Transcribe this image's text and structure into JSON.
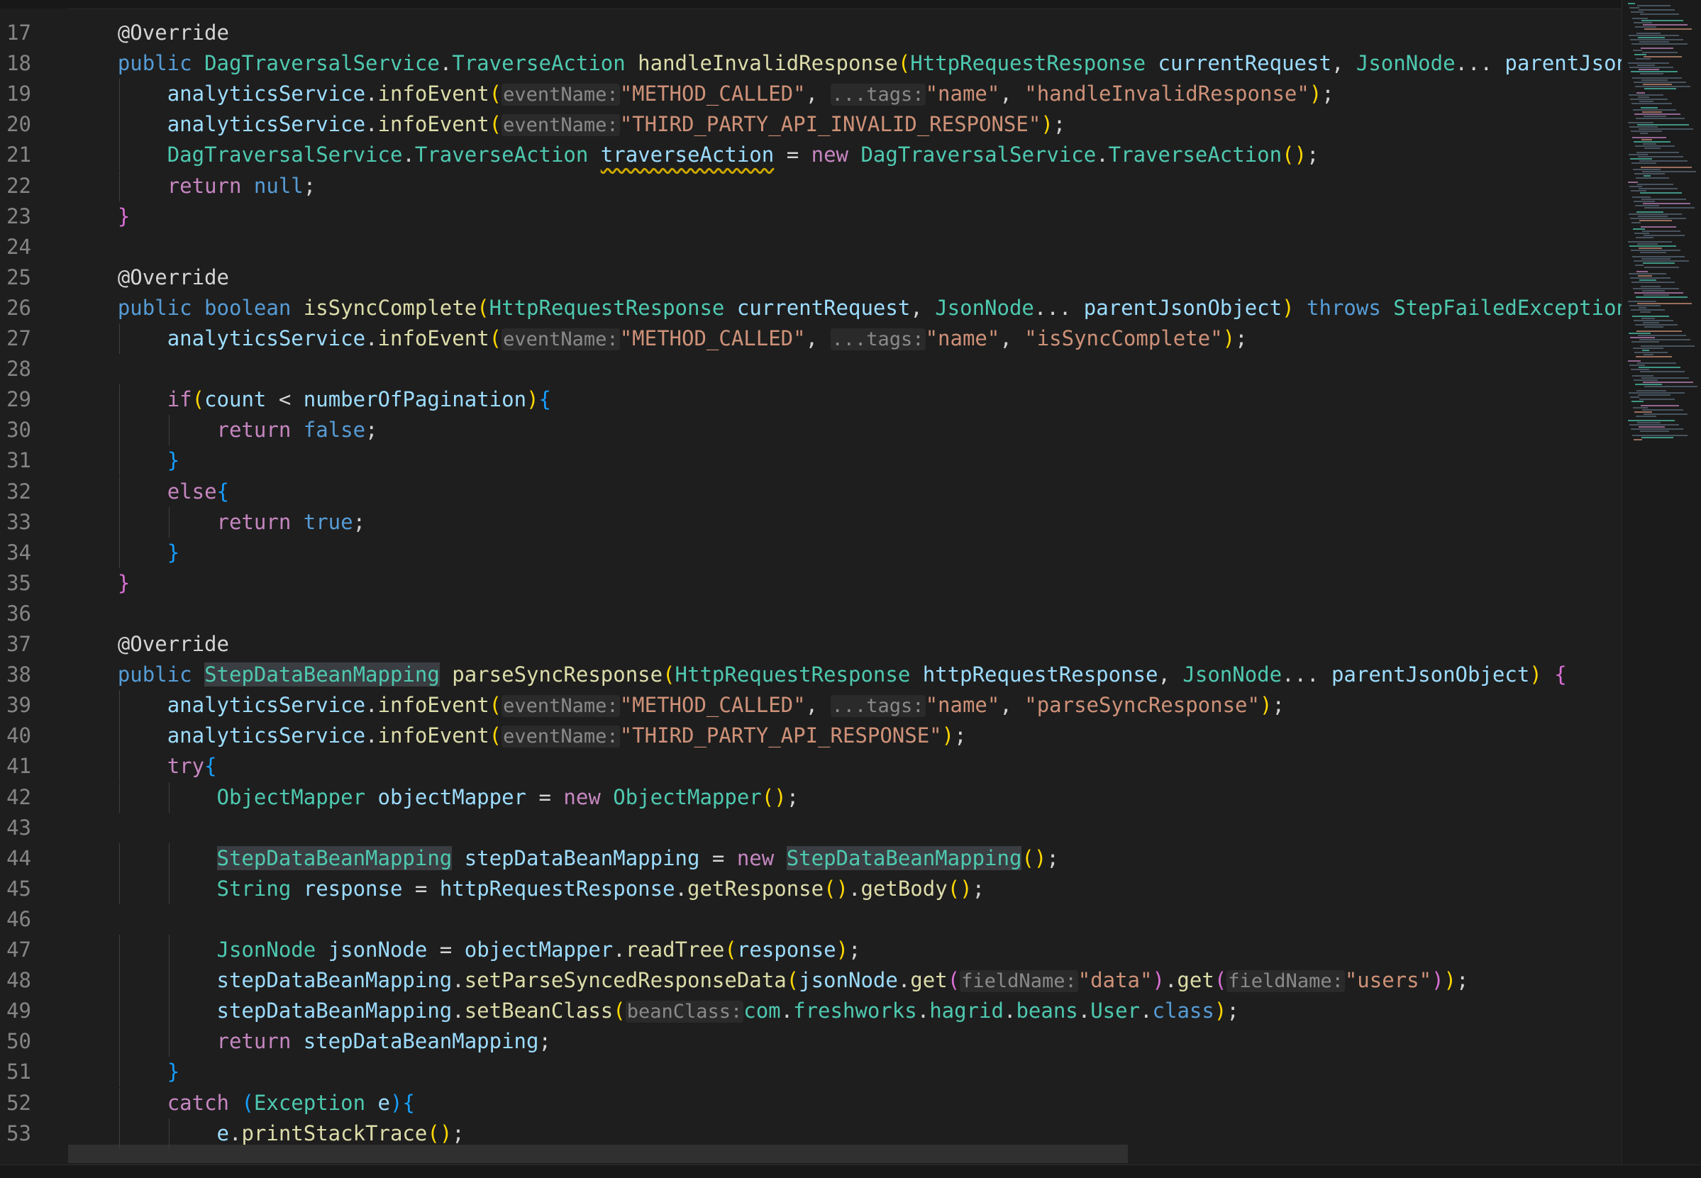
{
  "editor": {
    "lines": [
      {
        "n": "17",
        "indent": 1,
        "tokens": [
          {
            "c": "a",
            "t": "@Override"
          }
        ]
      },
      {
        "n": "18",
        "indent": 1,
        "tokens": [
          {
            "c": "kb",
            "t": "public "
          },
          {
            "c": "t",
            "t": "DagTraversalService"
          },
          {
            "c": "a",
            "t": "."
          },
          {
            "c": "t",
            "t": "TraverseAction "
          },
          {
            "c": "f",
            "t": "handleInvalidResponse"
          },
          {
            "c": "br1",
            "t": "("
          },
          {
            "c": "t",
            "t": "HttpRequestResponse "
          },
          {
            "c": "v",
            "t": "currentRequest"
          },
          {
            "c": "a",
            "t": ", "
          },
          {
            "c": "t",
            "t": "JsonNode"
          },
          {
            "c": "a",
            "t": "... "
          },
          {
            "c": "v",
            "t": "parentJsonO"
          }
        ]
      },
      {
        "n": "19",
        "indent": 2,
        "tokens": [
          {
            "c": "v",
            "t": "analyticsService"
          },
          {
            "c": "a",
            "t": "."
          },
          {
            "c": "f",
            "t": "infoEvent"
          },
          {
            "c": "br1",
            "t": "("
          },
          {
            "c": "hint",
            "t": "eventName:"
          },
          {
            "c": "s",
            "t": "\"METHOD_CALLED\""
          },
          {
            "c": "a",
            "t": ", "
          },
          {
            "c": "hint",
            "t": "...tags:"
          },
          {
            "c": "s",
            "t": "\"name\""
          },
          {
            "c": "a",
            "t": ", "
          },
          {
            "c": "s",
            "t": "\"handleInvalidResponse\""
          },
          {
            "c": "br1",
            "t": ")"
          },
          {
            "c": "a",
            "t": ";"
          }
        ]
      },
      {
        "n": "20",
        "indent": 2,
        "tokens": [
          {
            "c": "v",
            "t": "analyticsService"
          },
          {
            "c": "a",
            "t": "."
          },
          {
            "c": "f",
            "t": "infoEvent"
          },
          {
            "c": "br1",
            "t": "("
          },
          {
            "c": "hint",
            "t": "eventName:"
          },
          {
            "c": "s",
            "t": "\"THIRD_PARTY_API_INVALID_RESPONSE\""
          },
          {
            "c": "br1",
            "t": ")"
          },
          {
            "c": "a",
            "t": ";"
          }
        ]
      },
      {
        "n": "21",
        "indent": 2,
        "tokens": [
          {
            "c": "t",
            "t": "DagTraversalService"
          },
          {
            "c": "a",
            "t": "."
          },
          {
            "c": "t",
            "t": "TraverseAction "
          },
          {
            "c": "v squig",
            "t": "traverseAction"
          },
          {
            "c": "a",
            "t": " = "
          },
          {
            "c": "k",
            "t": "new "
          },
          {
            "c": "t",
            "t": "DagTraversalService"
          },
          {
            "c": "a",
            "t": "."
          },
          {
            "c": "t",
            "t": "TraverseAction"
          },
          {
            "c": "br1",
            "t": "()"
          },
          {
            "c": "a",
            "t": ";"
          }
        ]
      },
      {
        "n": "22",
        "indent": 2,
        "tokens": [
          {
            "c": "k",
            "t": "return "
          },
          {
            "c": "kb",
            "t": "null"
          },
          {
            "c": "a",
            "t": ";"
          }
        ]
      },
      {
        "n": "23",
        "indent": 1,
        "tokens": [
          {
            "c": "br2",
            "t": "}"
          }
        ]
      },
      {
        "n": "24",
        "indent": 0,
        "tokens": []
      },
      {
        "n": "25",
        "indent": 1,
        "tokens": [
          {
            "c": "a",
            "t": "@Override"
          }
        ]
      },
      {
        "n": "26",
        "indent": 1,
        "tokens": [
          {
            "c": "kb",
            "t": "public boolean "
          },
          {
            "c": "f",
            "t": "isSyncComplete"
          },
          {
            "c": "br1",
            "t": "("
          },
          {
            "c": "t",
            "t": "HttpRequestResponse "
          },
          {
            "c": "v",
            "t": "currentRequest"
          },
          {
            "c": "a",
            "t": ", "
          },
          {
            "c": "t",
            "t": "JsonNode"
          },
          {
            "c": "a",
            "t": "... "
          },
          {
            "c": "v",
            "t": "parentJsonObject"
          },
          {
            "c": "br1",
            "t": ")"
          },
          {
            "c": "kb",
            "t": " throws "
          },
          {
            "c": "t",
            "t": "StepFailedException"
          }
        ]
      },
      {
        "n": "27",
        "indent": 2,
        "tokens": [
          {
            "c": "v",
            "t": "analyticsService"
          },
          {
            "c": "a",
            "t": "."
          },
          {
            "c": "f",
            "t": "infoEvent"
          },
          {
            "c": "br1",
            "t": "("
          },
          {
            "c": "hint",
            "t": "eventName:"
          },
          {
            "c": "s",
            "t": "\"METHOD_CALLED\""
          },
          {
            "c": "a",
            "t": ", "
          },
          {
            "c": "hint",
            "t": "...tags:"
          },
          {
            "c": "s",
            "t": "\"name\""
          },
          {
            "c": "a",
            "t": ", "
          },
          {
            "c": "s",
            "t": "\"isSyncComplete\""
          },
          {
            "c": "br1",
            "t": ")"
          },
          {
            "c": "a",
            "t": ";"
          }
        ]
      },
      {
        "n": "28",
        "indent": 0,
        "tokens": []
      },
      {
        "n": "29",
        "indent": 2,
        "tokens": [
          {
            "c": "k",
            "t": "if"
          },
          {
            "c": "br1",
            "t": "("
          },
          {
            "c": "v",
            "t": "count"
          },
          {
            "c": "a",
            "t": " < "
          },
          {
            "c": "v",
            "t": "numberOfPagination"
          },
          {
            "c": "br1",
            "t": ")"
          },
          {
            "c": "br3",
            "t": "{"
          }
        ]
      },
      {
        "n": "30",
        "indent": 3,
        "tokens": [
          {
            "c": "k",
            "t": "return "
          },
          {
            "c": "kb",
            "t": "false"
          },
          {
            "c": "a",
            "t": ";"
          }
        ]
      },
      {
        "n": "31",
        "indent": 2,
        "tokens": [
          {
            "c": "br3",
            "t": "}"
          }
        ]
      },
      {
        "n": "32",
        "indent": 2,
        "tokens": [
          {
            "c": "k",
            "t": "else"
          },
          {
            "c": "br3",
            "t": "{"
          }
        ]
      },
      {
        "n": "33",
        "indent": 3,
        "tokens": [
          {
            "c": "k",
            "t": "return "
          },
          {
            "c": "kb",
            "t": "true"
          },
          {
            "c": "a",
            "t": ";"
          }
        ]
      },
      {
        "n": "34",
        "indent": 2,
        "tokens": [
          {
            "c": "br3",
            "t": "}"
          }
        ]
      },
      {
        "n": "35",
        "indent": 1,
        "tokens": [
          {
            "c": "br2",
            "t": "}"
          }
        ]
      },
      {
        "n": "36",
        "indent": 0,
        "tokens": []
      },
      {
        "n": "37",
        "indent": 1,
        "tokens": [
          {
            "c": "a",
            "t": "@Override"
          }
        ]
      },
      {
        "n": "38",
        "indent": 1,
        "tokens": [
          {
            "c": "kb",
            "t": "public "
          },
          {
            "c": "t hl",
            "t": "StepDataBeanMapping"
          },
          {
            "c": "a",
            "t": " "
          },
          {
            "c": "f",
            "t": "parseSyncResponse"
          },
          {
            "c": "br1",
            "t": "("
          },
          {
            "c": "t",
            "t": "HttpRequestResponse "
          },
          {
            "c": "v",
            "t": "httpRequestResponse"
          },
          {
            "c": "a",
            "t": ", "
          },
          {
            "c": "t",
            "t": "JsonNode"
          },
          {
            "c": "a",
            "t": "... "
          },
          {
            "c": "v",
            "t": "parentJsonObject"
          },
          {
            "c": "br1",
            "t": ")"
          },
          {
            "c": "a",
            "t": " "
          },
          {
            "c": "br2",
            "t": "{"
          }
        ]
      },
      {
        "n": "39",
        "indent": 2,
        "tokens": [
          {
            "c": "v",
            "t": "analyticsService"
          },
          {
            "c": "a",
            "t": "."
          },
          {
            "c": "f",
            "t": "infoEvent"
          },
          {
            "c": "br1",
            "t": "("
          },
          {
            "c": "hint",
            "t": "eventName:"
          },
          {
            "c": "s",
            "t": "\"METHOD_CALLED\""
          },
          {
            "c": "a",
            "t": ", "
          },
          {
            "c": "hint",
            "t": "...tags:"
          },
          {
            "c": "s",
            "t": "\"name\""
          },
          {
            "c": "a",
            "t": ", "
          },
          {
            "c": "s",
            "t": "\"parseSyncResponse\""
          },
          {
            "c": "br1",
            "t": ")"
          },
          {
            "c": "a",
            "t": ";"
          }
        ]
      },
      {
        "n": "40",
        "indent": 2,
        "tokens": [
          {
            "c": "v",
            "t": "analyticsService"
          },
          {
            "c": "a",
            "t": "."
          },
          {
            "c": "f",
            "t": "infoEvent"
          },
          {
            "c": "br1",
            "t": "("
          },
          {
            "c": "hint",
            "t": "eventName:"
          },
          {
            "c": "s",
            "t": "\"THIRD_PARTY_API_RESPONSE\""
          },
          {
            "c": "br1",
            "t": ")"
          },
          {
            "c": "a",
            "t": ";"
          }
        ]
      },
      {
        "n": "41",
        "indent": 2,
        "tokens": [
          {
            "c": "k",
            "t": "try"
          },
          {
            "c": "br3",
            "t": "{"
          }
        ]
      },
      {
        "n": "42",
        "indent": 3,
        "tokens": [
          {
            "c": "t",
            "t": "ObjectMapper "
          },
          {
            "c": "v",
            "t": "objectMapper"
          },
          {
            "c": "a",
            "t": " = "
          },
          {
            "c": "k",
            "t": "new "
          },
          {
            "c": "t",
            "t": "ObjectMapper"
          },
          {
            "c": "br1",
            "t": "()"
          },
          {
            "c": "a",
            "t": ";"
          }
        ]
      },
      {
        "n": "43",
        "indent": 0,
        "tokens": []
      },
      {
        "n": "44",
        "indent": 3,
        "tokens": [
          {
            "c": "t hl",
            "t": "StepDataBeanMapping"
          },
          {
            "c": "a",
            "t": " "
          },
          {
            "c": "v",
            "t": "stepDataBeanMapping"
          },
          {
            "c": "a",
            "t": " = "
          },
          {
            "c": "k",
            "t": "new "
          },
          {
            "c": "t hl",
            "t": "StepDataBeanMapping"
          },
          {
            "c": "br1",
            "t": "()"
          },
          {
            "c": "a",
            "t": ";"
          }
        ]
      },
      {
        "n": "45",
        "indent": 3,
        "tokens": [
          {
            "c": "t",
            "t": "String "
          },
          {
            "c": "v",
            "t": "response"
          },
          {
            "c": "a",
            "t": " = "
          },
          {
            "c": "v",
            "t": "httpRequestResponse"
          },
          {
            "c": "a",
            "t": "."
          },
          {
            "c": "f",
            "t": "getResponse"
          },
          {
            "c": "br1",
            "t": "()"
          },
          {
            "c": "a",
            "t": "."
          },
          {
            "c": "f",
            "t": "getBody"
          },
          {
            "c": "br1",
            "t": "()"
          },
          {
            "c": "a",
            "t": ";"
          }
        ]
      },
      {
        "n": "46",
        "indent": 0,
        "tokens": []
      },
      {
        "n": "47",
        "indent": 3,
        "tokens": [
          {
            "c": "t",
            "t": "JsonNode "
          },
          {
            "c": "v",
            "t": "jsonNode"
          },
          {
            "c": "a",
            "t": " = "
          },
          {
            "c": "v",
            "t": "objectMapper"
          },
          {
            "c": "a",
            "t": "."
          },
          {
            "c": "f",
            "t": "readTree"
          },
          {
            "c": "br1",
            "t": "("
          },
          {
            "c": "v",
            "t": "response"
          },
          {
            "c": "br1",
            "t": ")"
          },
          {
            "c": "a",
            "t": ";"
          }
        ]
      },
      {
        "n": "48",
        "indent": 3,
        "tokens": [
          {
            "c": "v",
            "t": "stepDataBeanMapping"
          },
          {
            "c": "a",
            "t": "."
          },
          {
            "c": "f",
            "t": "setParseSyncedResponseData"
          },
          {
            "c": "br1",
            "t": "("
          },
          {
            "c": "v",
            "t": "jsonNode"
          },
          {
            "c": "a",
            "t": "."
          },
          {
            "c": "f",
            "t": "get"
          },
          {
            "c": "br2",
            "t": "("
          },
          {
            "c": "hint",
            "t": "fieldName:"
          },
          {
            "c": "s",
            "t": "\"data\""
          },
          {
            "c": "br2",
            "t": ")"
          },
          {
            "c": "a",
            "t": "."
          },
          {
            "c": "f",
            "t": "get"
          },
          {
            "c": "br2",
            "t": "("
          },
          {
            "c": "hint",
            "t": "fieldName:"
          },
          {
            "c": "s",
            "t": "\"users\""
          },
          {
            "c": "br2",
            "t": ")"
          },
          {
            "c": "br1",
            "t": ")"
          },
          {
            "c": "a",
            "t": ";"
          }
        ]
      },
      {
        "n": "49",
        "indent": 3,
        "tokens": [
          {
            "c": "v",
            "t": "stepDataBeanMapping"
          },
          {
            "c": "a",
            "t": "."
          },
          {
            "c": "f",
            "t": "setBeanClass"
          },
          {
            "c": "br1",
            "t": "("
          },
          {
            "c": "hint",
            "t": "beanClass:"
          },
          {
            "c": "t",
            "t": "com"
          },
          {
            "c": "a",
            "t": "."
          },
          {
            "c": "t",
            "t": "freshworks"
          },
          {
            "c": "a",
            "t": "."
          },
          {
            "c": "t",
            "t": "hagrid"
          },
          {
            "c": "a",
            "t": "."
          },
          {
            "c": "t",
            "t": "beans"
          },
          {
            "c": "a",
            "t": "."
          },
          {
            "c": "t",
            "t": "User"
          },
          {
            "c": "a",
            "t": "."
          },
          {
            "c": "kb",
            "t": "class"
          },
          {
            "c": "br1",
            "t": ")"
          },
          {
            "c": "a",
            "t": ";"
          }
        ]
      },
      {
        "n": "50",
        "indent": 3,
        "tokens": [
          {
            "c": "k",
            "t": "return "
          },
          {
            "c": "v",
            "t": "stepDataBeanMapping"
          },
          {
            "c": "a",
            "t": ";"
          }
        ]
      },
      {
        "n": "51",
        "indent": 2,
        "tokens": [
          {
            "c": "br3",
            "t": "}"
          }
        ]
      },
      {
        "n": "52",
        "indent": 2,
        "tokens": [
          {
            "c": "k",
            "t": "catch "
          },
          {
            "c": "br3",
            "t": "("
          },
          {
            "c": "t",
            "t": "Exception "
          },
          {
            "c": "v",
            "t": "e"
          },
          {
            "c": "br3",
            "t": ")"
          },
          {
            "c": "br3",
            "t": "{"
          }
        ]
      },
      {
        "n": "53",
        "indent": 3,
        "tokens": [
          {
            "c": "v",
            "t": "e"
          },
          {
            "c": "a",
            "t": "."
          },
          {
            "c": "f",
            "t": "printStackTrace"
          },
          {
            "c": "br1",
            "t": "()"
          },
          {
            "c": "a",
            "t": ";"
          }
        ]
      }
    ]
  },
  "colors": {
    "background": "#1e1e1e",
    "keyword": "#c586c0",
    "type": "#4ec9b0",
    "function": "#dcdcaa",
    "variable": "#9cdcfe",
    "string": "#ce9178"
  }
}
